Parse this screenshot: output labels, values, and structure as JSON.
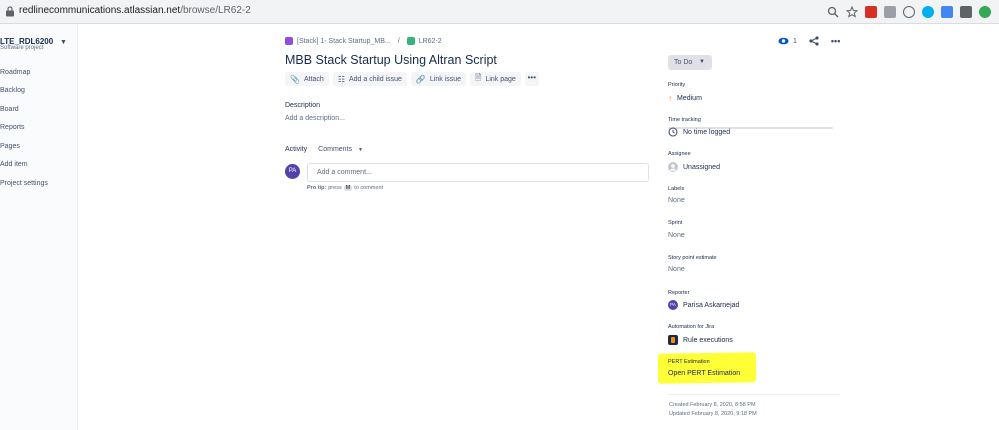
{
  "browser": {
    "host": "redlinecommunications.atlassian.net",
    "path": "/browse/LR62-2"
  },
  "sidebar": {
    "project_name": "LTE_RDL6200",
    "project_type": "Software project",
    "items": [
      {
        "label": "Roadmap"
      },
      {
        "label": "Backlog"
      },
      {
        "label": "Board"
      },
      {
        "label": "Reports"
      },
      {
        "label": "Pages"
      },
      {
        "label": "Add item"
      },
      {
        "label": "Project settings"
      }
    ]
  },
  "breadcrumb": {
    "parent": "[Stack] 1- Stack Startup_MB...",
    "separator": "/",
    "issue_key": "LR62-2"
  },
  "issue": {
    "title": "MBB Stack Startup Using Altran Script"
  },
  "toolbar": {
    "attach": "Attach",
    "add_child": "Add a child issue",
    "link_issue": "Link issue",
    "link_page": "Link page",
    "more": "•••"
  },
  "description": {
    "heading": "Description",
    "placeholder": "Add a description..."
  },
  "activity": {
    "heading": "Activity",
    "filter": "Comments",
    "avatar_initials": "PA",
    "comment_placeholder": "Add a comment...",
    "protip_prefix": "Pro tip:",
    "protip_press": "press",
    "protip_key": "M",
    "protip_suffix": "to comment"
  },
  "header_actions": {
    "watch_count": "1"
  },
  "status": {
    "label": "To Do"
  },
  "fields": {
    "priority_label": "Priority",
    "priority_value": "Medium",
    "time_label": "Time tracking",
    "time_value": "No time logged",
    "assignee_label": "Assignee",
    "assignee_value": "Unassigned",
    "labels_label": "Labels",
    "labels_value": "None",
    "sprint_label": "Sprint",
    "sprint_value": "None",
    "story_label": "Story point estimate",
    "story_value": "None",
    "reporter_label": "Reporter",
    "reporter_initials": "PA",
    "reporter_value": "Parisa Askarnejad",
    "automation_label": "Automation for Jira",
    "automation_value": "Rule executions",
    "pert_label": "PERT Estimation",
    "pert_value": "Open PERT Estimation"
  },
  "meta": {
    "created": "Created February 8, 2020, 8:58 PM",
    "updated": "Updated February 8, 2020, 9:18 PM"
  },
  "colors": {
    "accent": "#0052cc",
    "highlight": "#ffff38",
    "priority_medium": "#ff8b00",
    "avatar": "#5243aa"
  }
}
